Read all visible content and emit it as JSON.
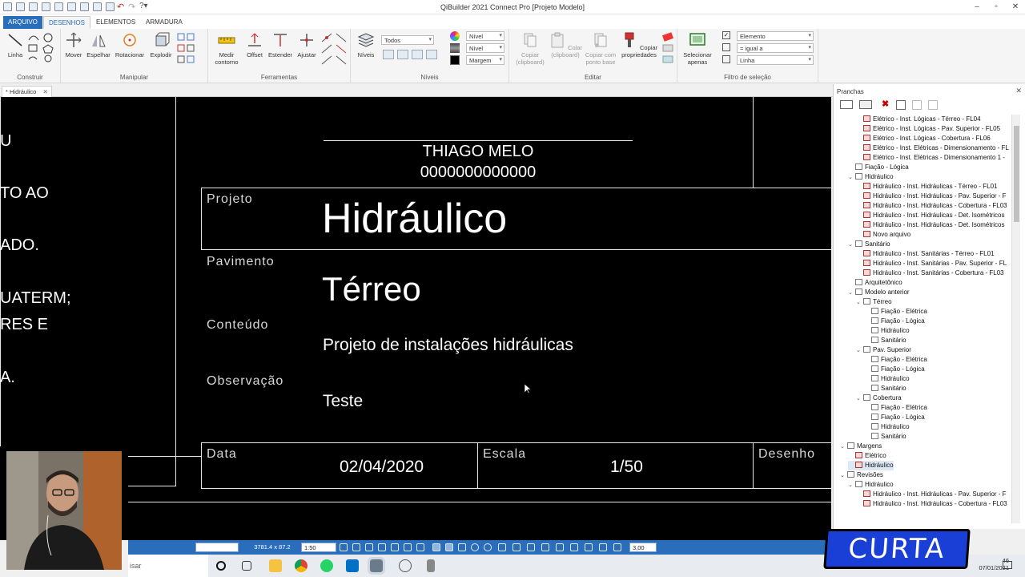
{
  "window": {
    "title": "QiBuilder 2021 Connect Pro [Projeto Modelo]"
  },
  "menu_tabs": [
    "ARQUIVO",
    "DESENHOS",
    "ELEMENTOS",
    "ARMADURA"
  ],
  "ribbon": {
    "construir": {
      "label": "Construir",
      "buttons": [
        "Linha"
      ]
    },
    "manipular": {
      "label": "Manipular",
      "buttons": [
        "Mover",
        "Espelhar",
        "Rotacionar",
        "Explodir"
      ]
    },
    "ferramentas": {
      "label": "Ferramentas",
      "buttons": [
        "Medir contorno",
        "Offset",
        "Estender",
        "Ajustar"
      ]
    },
    "niveis": {
      "label": "Níveis",
      "button": "Níveis",
      "combo_todos": "Todos",
      "combo_nivel1": "Nível",
      "combo_nivel2": "Nível",
      "combo_margem": "Margem"
    },
    "editar": {
      "label": "Editar",
      "buttons": [
        "Copiar (clipboard)",
        "Colar (clipboard)",
        "Copiar com ponto base",
        "Copiar propriedades"
      ]
    },
    "selecao": {
      "label": "Filtro de seleção",
      "button": "Selecionar apenas",
      "filter1": "Elemento",
      "filter2": "= igual a",
      "filter3": "Linha"
    }
  },
  "document_tab": "* Hidráulico",
  "canvas": {
    "left_fragments": [
      "U",
      "TO AO",
      "ADO.",
      "UATERM;",
      "RES E",
      "A."
    ],
    "owner_name": "THIAGO MELO",
    "owner_id": "0000000000000",
    "projeto_label": "Projeto",
    "projeto_value": "Hidráulico",
    "pavimento_label": "Pavimento",
    "pavimento_value": "Térreo",
    "conteudo_label": "Conteúdo",
    "conteudo_value": "Projeto de instalações hidráulicas",
    "observacao_label": "Observação",
    "observacao_value": "Teste",
    "data_label": "Data",
    "data_value": "02/04/2020",
    "escala_label": "Escala",
    "escala_value": "1/50",
    "desenho_label": "Desenho"
  },
  "panel": {
    "title": "Pranchas",
    "tree": [
      {
        "label": "Elétrico - Inst. Lógicas - Térreo - FL04",
        "level": 3,
        "icon": "red"
      },
      {
        "label": "Elétrico - Inst. Lógicas - Pav. Superior - FL05",
        "level": 3,
        "icon": "red"
      },
      {
        "label": "Elétrico - Inst. Lógicas - Cobertura - FL06",
        "level": 3,
        "icon": "red"
      },
      {
        "label": "Elétrico - Inst. Elétricas - Dimensionamento - FL",
        "level": 3,
        "icon": "red"
      },
      {
        "label": "Elétrico - Inst. Elétricas - Dimensionamento 1 -",
        "level": 3,
        "icon": "red"
      },
      {
        "label": "Fiação - Lógica",
        "level": 2,
        "icon": "folder"
      },
      {
        "label": "Hidráulico",
        "level": 2,
        "icon": "folder",
        "toggle": "˅"
      },
      {
        "label": "Hidráulico - Inst. Hidráulicas - Térreo - FL01",
        "level": 3,
        "icon": "red"
      },
      {
        "label": "Hidráulico - Inst. Hidráulicas - Pav. Superior - F",
        "level": 3,
        "icon": "red"
      },
      {
        "label": "Hidráulico - Inst. Hidráulicas - Cobertura - FL03",
        "level": 3,
        "icon": "red"
      },
      {
        "label": "Hidráulico - Inst. Hidráulicas - Det. Isométricos",
        "level": 3,
        "icon": "red"
      },
      {
        "label": "Hidráulico - Inst. Hidráulicas - Det. Isométricos",
        "level": 3,
        "icon": "red"
      },
      {
        "label": "Novo arquivo",
        "level": 3,
        "icon": "red"
      },
      {
        "label": "Sanitário",
        "level": 2,
        "icon": "folder",
        "toggle": "˅"
      },
      {
        "label": "Hidráulico - Inst. Sanitárias - Térreo - FL01",
        "level": 3,
        "icon": "red"
      },
      {
        "label": "Hidráulico - Inst. Sanitárias - Pav. Superior - FL",
        "level": 3,
        "icon": "red"
      },
      {
        "label": "Hidráulico - Inst. Sanitárias - Cobertura - FL03",
        "level": 3,
        "icon": "red"
      },
      {
        "label": "Arquitetônico",
        "level": 2,
        "icon": "folder"
      },
      {
        "label": "Modelo anterior",
        "level": 2,
        "icon": "folder",
        "toggle": "˅"
      },
      {
        "label": "Térreo",
        "level": 3,
        "icon": "folder",
        "toggle": "˅"
      },
      {
        "label": "Fiação - Elétrica",
        "level": 4,
        "icon": "folder"
      },
      {
        "label": "Fiação - Lógica",
        "level": 4,
        "icon": "folder"
      },
      {
        "label": "Hidráulico",
        "level": 4,
        "icon": "folder"
      },
      {
        "label": "Sanitário",
        "level": 4,
        "icon": "folder"
      },
      {
        "label": "Pav. Superior",
        "level": 3,
        "icon": "folder",
        "toggle": "˅"
      },
      {
        "label": "Fiação - Elétrica",
        "level": 4,
        "icon": "folder"
      },
      {
        "label": "Fiação - Lógica",
        "level": 4,
        "icon": "folder"
      },
      {
        "label": "Hidráulico",
        "level": 4,
        "icon": "folder"
      },
      {
        "label": "Sanitário",
        "level": 4,
        "icon": "folder"
      },
      {
        "label": "Cobertura",
        "level": 3,
        "icon": "folder",
        "toggle": "˅"
      },
      {
        "label": "Fiação - Elétrica",
        "level": 4,
        "icon": "folder"
      },
      {
        "label": "Fiação - Lógica",
        "level": 4,
        "icon": "folder"
      },
      {
        "label": "Hidráulico",
        "level": 4,
        "icon": "folder"
      },
      {
        "label": "Sanitário",
        "level": 4,
        "icon": "folder"
      },
      {
        "label": "Margens",
        "level": 1,
        "icon": "folder",
        "toggle": "˅"
      },
      {
        "label": "Elétrico",
        "level": 2,
        "icon": "red"
      },
      {
        "label": "Hidráulico",
        "level": 2,
        "icon": "red",
        "selected": true
      },
      {
        "label": "Revisões",
        "level": 1,
        "icon": "folder",
        "toggle": "˅"
      },
      {
        "label": "Hidráulico",
        "level": 2,
        "icon": "folder",
        "toggle": "˅"
      },
      {
        "label": "Hidráulico - Inst. Hidráulicas - Pav. Superior - F",
        "level": 3,
        "icon": "red"
      },
      {
        "label": "Hidráulico - Inst. Hidráulicas - Cobertura - FL03",
        "level": 3,
        "icon": "red"
      }
    ]
  },
  "statusbar": {
    "coords": "3781.4 x 87.2",
    "scale": "1:50",
    "value": "3,00"
  },
  "taskbar": {
    "search_text": "isar",
    "clock_time": "46",
    "clock_date": "07/01/2021"
  },
  "overlay": {
    "badge": "CURTA"
  },
  "colors": {
    "accent": "#2a6ebb",
    "canvas": "#000000",
    "badge": "#1a3fd6"
  }
}
